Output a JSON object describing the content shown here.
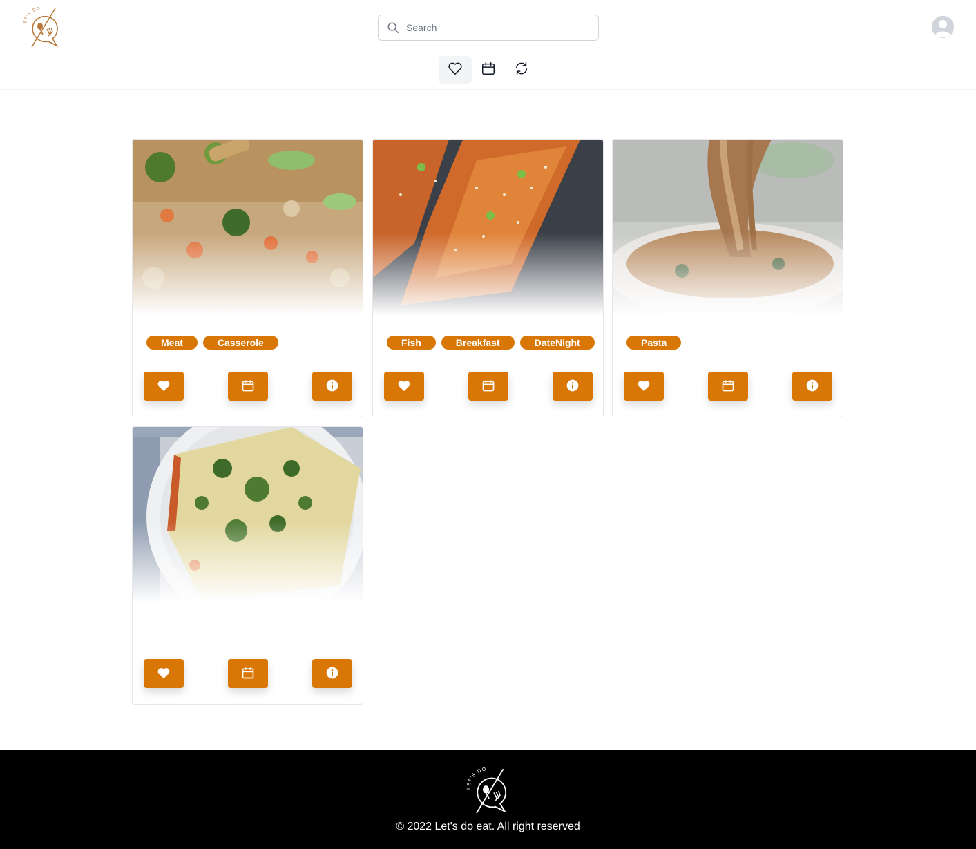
{
  "header": {
    "logo_icon": "lets-do-eat-logo",
    "logo_text": "LET'S DO EAT",
    "search_placeholder": "Search",
    "avatar_icon": "user-avatar-icon"
  },
  "subnav": {
    "items": [
      {
        "icon": "heart-outline-icon",
        "active": true
      },
      {
        "icon": "calendar-outline-icon",
        "active": false
      },
      {
        "icon": "refresh-icon",
        "active": false
      }
    ]
  },
  "recipes": [
    {
      "image": "chicken-rice-casserole",
      "tags": [
        "Meat",
        "Casserole"
      ]
    },
    {
      "image": "glazed-salmon-sesame",
      "tags": [
        "Fish",
        "Breakfast",
        "DateNight"
      ]
    },
    {
      "image": "creamy-pasta-fork",
      "tags": [
        "Pasta"
      ]
    },
    {
      "image": "lasagna-plate",
      "tags": []
    }
  ],
  "card_actions": [
    "heart-icon",
    "calendar-icon",
    "info-icon"
  ],
  "colors": {
    "accent": "#d97706",
    "footer_bg": "#000000",
    "border": "#e5e7eb"
  },
  "footer": {
    "copyright": "© 2022 Let's do eat. All right reserved"
  }
}
